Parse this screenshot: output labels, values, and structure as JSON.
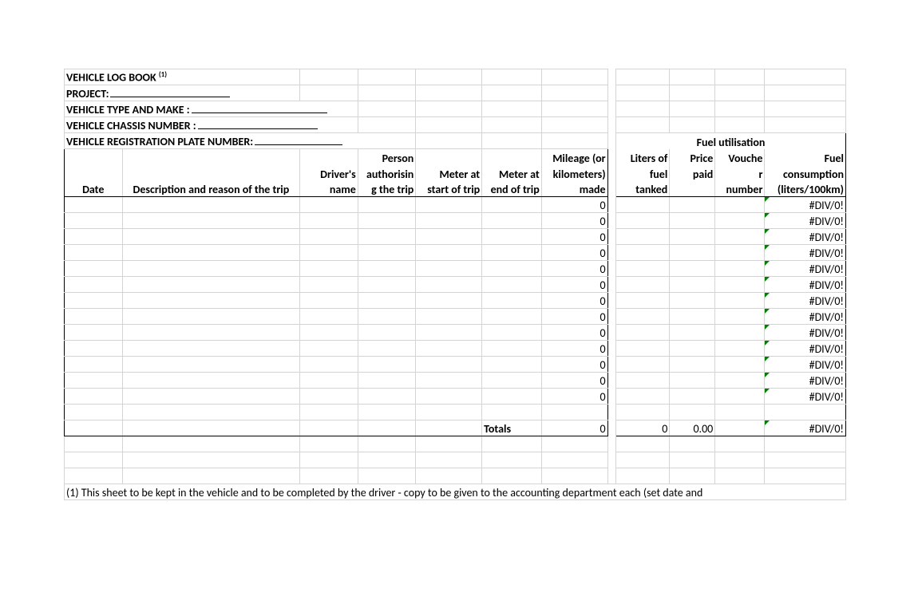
{
  "header": {
    "title_a": "VEHICLE LOG BOOK",
    "title_sup": "(1)",
    "project": "PROJECT:",
    "type_make": "VEHICLE TYPE AND MAKE :",
    "chassis": "VEHICLE CHASSIS NUMBER :",
    "reg_plate": "VEHICLE REGISTRATION PLATE NUMBER:"
  },
  "fuel_group": "Fuel utilisation",
  "cols": {
    "date": "Date",
    "desc": "Description and reason of the trip",
    "driver1": "Driver's",
    "driver2": "name",
    "person1": "Person",
    "person2": "authorisin",
    "person3": "g the trip",
    "mstart1": "Meter at",
    "mstart2": "start of trip",
    "mend1": "Meter at",
    "mend2": "end of trip",
    "mile1": "Mileage (or",
    "mile2": "kilometers)",
    "mile3": "made",
    "liters1": "Liters of",
    "liters2": "fuel",
    "liters3": "tanked",
    "price1": "Price",
    "price2": "paid",
    "vouch1": "Vouche",
    "vouch2": "r",
    "vouch3": "number",
    "fuel1": "Fuel",
    "fuel2": "consumption",
    "fuel3": "(liters/100km)"
  },
  "rows": [
    {
      "mileage": "0",
      "fuel": "#DIV/0!"
    },
    {
      "mileage": "0",
      "fuel": "#DIV/0!"
    },
    {
      "mileage": "0",
      "fuel": "#DIV/0!"
    },
    {
      "mileage": "0",
      "fuel": "#DIV/0!"
    },
    {
      "mileage": "0",
      "fuel": "#DIV/0!"
    },
    {
      "mileage": "0",
      "fuel": "#DIV/0!"
    },
    {
      "mileage": "0",
      "fuel": "#DIV/0!"
    },
    {
      "mileage": "0",
      "fuel": "#DIV/0!"
    },
    {
      "mileage": "0",
      "fuel": "#DIV/0!"
    },
    {
      "mileage": "0",
      "fuel": "#DIV/0!"
    },
    {
      "mileage": "0",
      "fuel": "#DIV/0!"
    },
    {
      "mileage": "0",
      "fuel": "#DIV/0!"
    },
    {
      "mileage": "0",
      "fuel": "#DIV/0!"
    }
  ],
  "totals": {
    "label": "Totals",
    "mileage": "0",
    "liters": "0",
    "price": "0.00",
    "fuel": "#DIV/0!"
  },
  "footnote": "(1)  This sheet to be kept in the vehicle and to be completed by the driver - copy to be given to the accounting department each (set date and"
}
